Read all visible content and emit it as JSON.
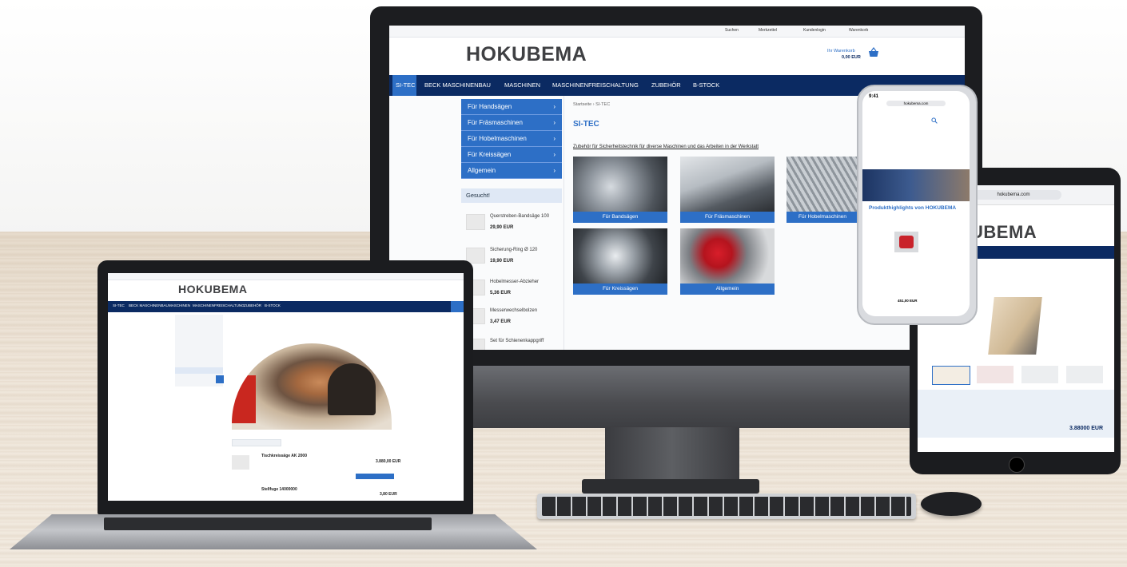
{
  "brand": {
    "logo": "HOKUBEMA"
  },
  "desktop": {
    "topbar_links": [
      "Suchen",
      "Merkzettel",
      "Kundenlogin",
      "Warenkorb"
    ],
    "cart": {
      "label": "Ihr Warenkorb",
      "amount": "0,00 EUR"
    },
    "nav": [
      "SI-TEC",
      "BECK MASCHINENBAU",
      "MASCHINEN",
      "MASCHINENFREISCHALTUNG",
      "ZUBEHÖR",
      "B-STOCK"
    ],
    "sidebar": [
      "Für Handsägen",
      "Für Fräsmaschinen",
      "Für Hobelmaschinen",
      "Für Kreissägen",
      "Allgemein"
    ],
    "sidebar_heading": "Gesucht!",
    "sidebar_products": [
      {
        "name": "Querstreben-Bandsäge 100",
        "price": "29,90 EUR"
      },
      {
        "name": "Sicherung-Ring Ø 120",
        "price": "19,90 EUR"
      },
      {
        "name": "Hobelmesser-Abzieher",
        "price": "5,36 EUR"
      },
      {
        "name": "Messerwechselbolzen",
        "price": "3,47 EUR"
      },
      {
        "name": "Set für Schienenkappgriff",
        "price": ""
      }
    ],
    "breadcrumb": [
      "Startseite",
      "SI-TEC"
    ],
    "page_title": "SI-TEC",
    "intro": "Zubehör für Sicherheitstechnik für diverse Maschinen und das Arbeiten in der Werkstatt",
    "tiles": [
      "Für Bandsägen",
      "Für Fräsmaschinen",
      "Für Hobelmaschinen",
      "Für Kreissägen",
      "Allgemein"
    ]
  },
  "laptop": {
    "nav": [
      "SI-TEC",
      "BECK MASCHINENBAU",
      "MASCHINEN",
      "MASCHINENFREISCHALTUNG",
      "ZUBEHÖR",
      "B-STOCK"
    ],
    "products": [
      {
        "name": "Tischkreissäge AK 2000",
        "price": "3.880,00 EUR"
      },
      {
        "name": "Stellfuge 14000000",
        "price": "3,80 EUR"
      }
    ]
  },
  "tablet": {
    "url": "hokubema.com",
    "logo_partial": "UBEMA",
    "price": "3.88000 EUR"
  },
  "phone": {
    "time": "9:41",
    "url": "hokubema.com",
    "section_title": "Produkthighlights von HOKUBEMA",
    "price": "451,00 EUR"
  },
  "colors": {
    "navy": "#0b2a62",
    "blue": "#2d6fc6",
    "logo_gray": "#3f4043"
  }
}
